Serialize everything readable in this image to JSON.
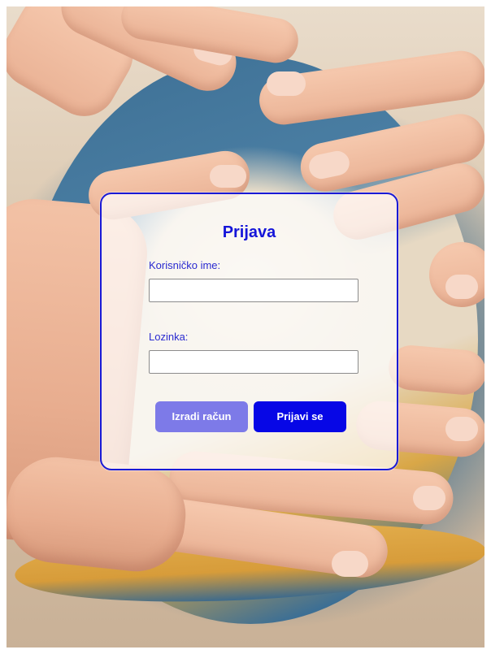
{
  "login_form": {
    "title": "Prijava",
    "username_label": "Korisničko ime:",
    "username_value": "",
    "password_label": "Lozinka:",
    "password_value": "",
    "register_button": "Izradi račun",
    "login_button": "Prijavi se"
  },
  "colors": {
    "accent": "#0707e6",
    "accent_light": "#7d7ae8",
    "card_border": "#1a1ad6",
    "title": "#1515d9"
  },
  "background": {
    "icon": "volleyball-photo"
  }
}
